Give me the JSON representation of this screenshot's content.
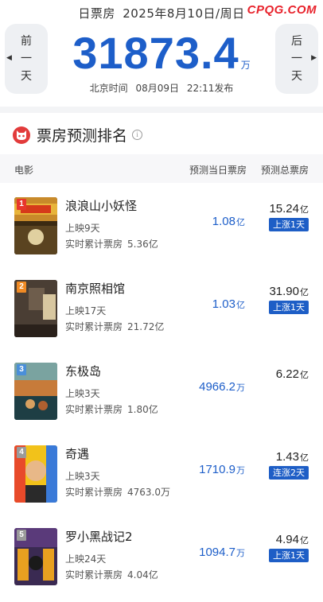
{
  "header": {
    "date_prefix": "日票房",
    "date": "2025年8月10日",
    "weekday": "/周日",
    "watermark": "CPQG.COM",
    "prev_label": [
      "前",
      "一",
      "天"
    ],
    "next_label": [
      "后",
      "一",
      "天"
    ],
    "total_value": "31873.4",
    "total_unit": "万",
    "pub_prefix": "北京时间",
    "pub_date": "08月09日",
    "pub_time": "22:11发布"
  },
  "section": {
    "title": "票房预测排名",
    "info": "i"
  },
  "columns": {
    "film": "电影",
    "predicted_today": "预测当日票房",
    "predicted_total": "预测总票房"
  },
  "films": [
    {
      "rank": "1",
      "name": "浪浪山小妖怪",
      "days": "上映9天",
      "cum_label": "实时累计票房",
      "cum_value": "5.36亿",
      "pred_num": "1.08",
      "pred_unit": "亿",
      "total_num": "15.24",
      "total_unit": "亿",
      "badge": "上涨1天",
      "rank_color": "#e8362c"
    },
    {
      "rank": "2",
      "name": "南京照相馆",
      "days": "上映17天",
      "cum_label": "实时累计票房",
      "cum_value": "21.72亿",
      "pred_num": "1.03",
      "pred_unit": "亿",
      "total_num": "31.90",
      "total_unit": "亿",
      "badge": "上涨1天",
      "rank_color": "#f08a24"
    },
    {
      "rank": "3",
      "name": "东极岛",
      "days": "上映3天",
      "cum_label": "实时累计票房",
      "cum_value": "1.80亿",
      "pred_num": "4966.2",
      "pred_unit": "万",
      "total_num": "6.22",
      "total_unit": "亿",
      "badge": "",
      "rank_color": "#4a8fd9"
    },
    {
      "rank": "4",
      "name": "奇遇",
      "days": "上映3天",
      "cum_label": "实时累计票房",
      "cum_value": "4763.0万",
      "pred_num": "1710.9",
      "pred_unit": "万",
      "total_num": "1.43",
      "total_unit": "亿",
      "badge": "连涨2天",
      "rank_color": "#9a9a9a"
    },
    {
      "rank": "5",
      "name": "罗小黑战记2",
      "days": "上映24天",
      "cum_label": "实时累计票房",
      "cum_value": "4.04亿",
      "pred_num": "1094.7",
      "pred_unit": "万",
      "total_num": "4.94",
      "total_unit": "亿",
      "badge": "上涨1天",
      "rank_color": "#9a9a9a"
    }
  ]
}
